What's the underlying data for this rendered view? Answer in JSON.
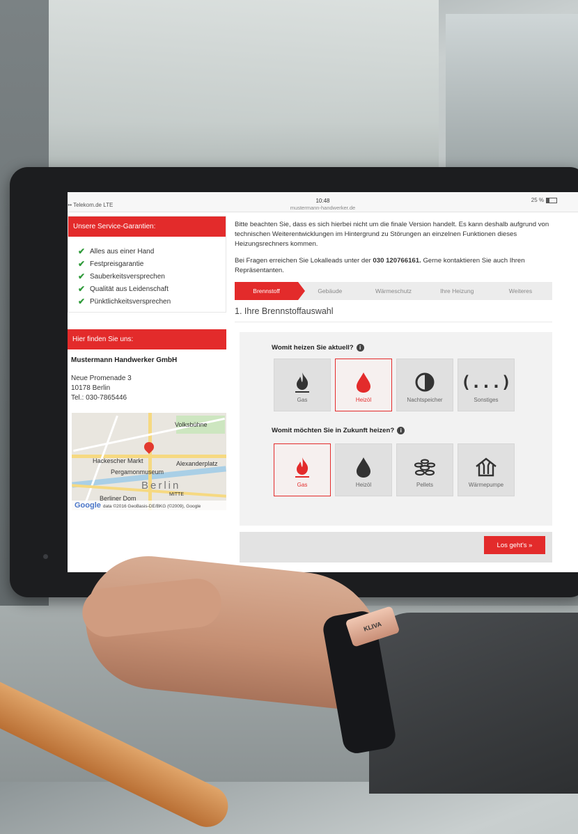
{
  "status_bar": {
    "carrier": "••••• Telekom.de  LTE",
    "time": "10:48",
    "url": "mustermann-handwerker.de",
    "battery": "25 %"
  },
  "left": {
    "guarantees_title": "Unsere Service-Garantien:",
    "guarantees": [
      "Alles aus einer Hand",
      "Festpreisgarantie",
      "Sauberkeitsversprechen",
      "Qualität aus Leidenschaft",
      "Pünktlichkeitsversprechen"
    ],
    "find_title": "Hier finden Sie uns:",
    "company": "Mustermann Handwerker GmbH",
    "address_street": "Neue Promenade 3",
    "address_city": "10178 Berlin",
    "address_phone": "Tel.: 030-7865446",
    "map": {
      "labels": {
        "volksbuehne": "Volksbühne",
        "hackescher": "Hackescher Markt",
        "alexanderplatz": "Alexanderplatz",
        "pergamon": "Pergamonmuseum",
        "berlin": "Berlin",
        "mitte": "MITTE",
        "dom": "Berliner Dom"
      },
      "google": "Google",
      "attribution": "data ©2016 GeoBasis-DE/BKG (©2009), Google"
    }
  },
  "right": {
    "notice": "Bitte beachten Sie, dass es sich hierbei nicht um die finale Version handelt. Es kann deshalb aufgrund von technischen Weiterentwicklungen im Hintergrund zu Störungen an einzelnen Funktionen dieses Heizungsrechners kommen.",
    "contact_prefix": "Bei Fragen erreichen Sie Lokalleads unter der",
    "contact_phone": "030 120766161.",
    "contact_suffix": "Gerne kontaktieren Sie auch Ihren Repräsentanten.",
    "steps": [
      "Brennstoff",
      "Gebäude",
      "Wärmeschutz",
      "Ihre Heizung",
      "Weiteres"
    ],
    "active_step": "Brennstoff",
    "section_title": "1. Ihre Brennstoffauswahl",
    "q1": "Womit heizen Sie aktuell?",
    "q1_options": [
      {
        "label": "Gas",
        "icon": "gas-flame-icon"
      },
      {
        "label": "Heizöl",
        "icon": "oil-drop-icon",
        "selected": true
      },
      {
        "label": "Nachtspeicher",
        "icon": "night-storage-icon"
      },
      {
        "label": "Sonstiges",
        "icon": "other-dots-icon",
        "symbol": "(...)"
      }
    ],
    "q2": "Womit möchten Sie in Zukunft heizen?",
    "q2_options": [
      {
        "label": "Gas",
        "icon": "gas-flame-icon",
        "selected": true
      },
      {
        "label": "Heizöl",
        "icon": "oil-drop-icon"
      },
      {
        "label": "Pellets",
        "icon": "pellets-icon"
      },
      {
        "label": "Wärmepumpe",
        "icon": "heat-pump-icon"
      }
    ],
    "go_button": "Los geht's »"
  },
  "watch_brand": "KLIVA",
  "colors": {
    "accent": "#e32b2b",
    "check": "#2e9a39"
  }
}
